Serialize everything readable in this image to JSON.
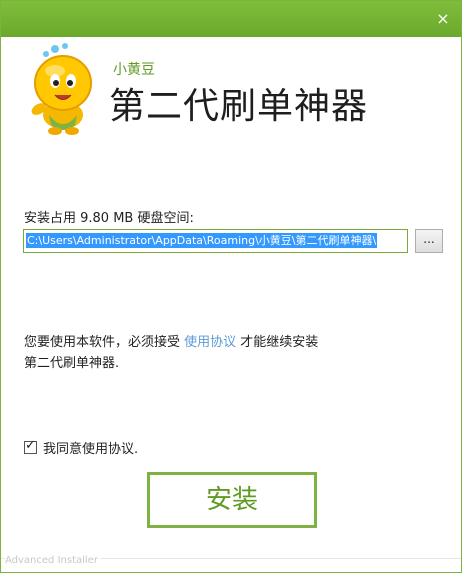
{
  "window": {
    "close_icon": "×"
  },
  "header": {
    "brand_small": "小黄豆",
    "app_title": "第二代刷单神器"
  },
  "install_path": {
    "space_label": "安装占用 9.80 MB 硬盘空间:",
    "value": "C:\\Users\\Administrator\\AppData\\Roaming\\小黄豆\\第二代刷单神器\\",
    "browse_label": "..."
  },
  "license": {
    "text_before": "您要使用本软件，必须接受 ",
    "link": "使用协议",
    "text_after": " 才能继续安装",
    "line2": "第二代刷单神器."
  },
  "agree": {
    "checked": true,
    "tick": "✓",
    "label": "我同意使用协议."
  },
  "install_button": {
    "label": "安装"
  },
  "footer": {
    "brand": "Advanced Installer"
  },
  "colors": {
    "accent": "#7cb342",
    "accent_text": "#5f9a22",
    "link": "#5b9bd5",
    "selection": "#3399ff"
  },
  "icons": {
    "mascot": "bean-mascot-icon",
    "close": "close-icon",
    "check": "check-icon"
  }
}
